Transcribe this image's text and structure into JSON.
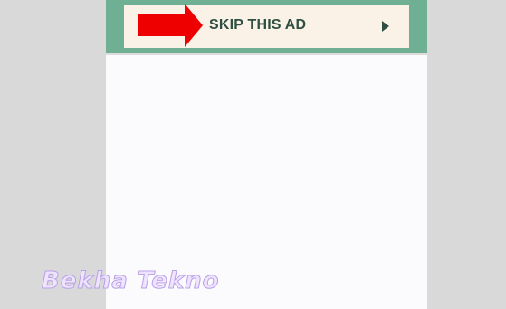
{
  "ad": {
    "skip_label": "SKIP THIS AD",
    "icon": "play-icon",
    "colors": {
      "banner": "#6fb094",
      "button": "#fbf2e7",
      "label": "#2f4f43",
      "arrow": "#ee0000"
    }
  },
  "overlay": {
    "watermark": "Bekha Tekno"
  }
}
